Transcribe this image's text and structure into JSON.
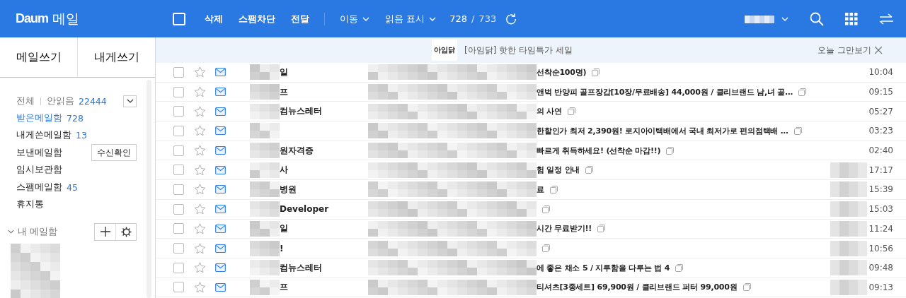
{
  "header": {
    "logo": "Daum",
    "service": "메일",
    "toolbar": [
      {
        "kind": "checkbox",
        "checked": false
      },
      {
        "kind": "button",
        "label": "삭제"
      },
      {
        "kind": "button",
        "label": "스팸차단"
      },
      {
        "kind": "button",
        "label": "전달"
      },
      {
        "kind": "separator"
      },
      {
        "kind": "dropdown",
        "label": "이동"
      },
      {
        "kind": "dropdown",
        "label": "읽음 표시"
      }
    ],
    "count": "728",
    "count_separator": "/",
    "total": "733"
  },
  "sidebar": {
    "compose": [
      "메일쓰기",
      "내게쓰기"
    ],
    "all": "전체",
    "unread_label": "안읽음",
    "unread_count": "22444",
    "folders": [
      {
        "label": "받은메일함",
        "count": "728",
        "selected": true
      },
      {
        "label": "내게쓴메일함",
        "count": "13",
        "selected": false
      },
      {
        "label": "보낸메일함",
        "button": "수신확인",
        "selected": false
      },
      {
        "label": "임시보관함",
        "selected": false
      },
      {
        "label": "스팸메일함",
        "count": "45",
        "selected": false
      },
      {
        "label": "휴지통",
        "selected": false
      }
    ],
    "my_mailbox": {
      "label": "내 메일함",
      "expanded": true
    }
  },
  "banner": {
    "logo": "아임닭",
    "text": "[아임닭] 핫한 타임특가 세일",
    "dismiss": "오늘 그만보기"
  },
  "mails": [
    {
      "sender": "일",
      "subject": "선착순100명)",
      "time": "10:04",
      "starred": false,
      "checked": false,
      "date_hidden": false
    },
    {
      "sender": "프",
      "subject": "앤벅 반양피 골프장갑[10장/무료배송] 44,000원 / 클리브랜드 남,녀 골…",
      "time": "09:15",
      "starred": false,
      "checked": false,
      "date_hidden": false
    },
    {
      "sender": "컴뉴스레터",
      "subject": "의 사연",
      "time": "05:27",
      "starred": false,
      "checked": false,
      "date_hidden": false
    },
    {
      "subject": "한할인가 최저 2,390원! 로지아이택배에서 국내 최저가로 편의점택배 …",
      "time": "03:23",
      "starred": false,
      "checked": false,
      "date_hidden": false
    },
    {
      "sender": "원자격증",
      "subject": "빠르게 취득하세요! (선착순 마감!!)",
      "time": "02:40",
      "starred": false,
      "checked": false,
      "date_hidden": false
    },
    {
      "sender": "사",
      "subject": "험 일정 안내",
      "time": "17:17",
      "starred": false,
      "checked": false,
      "date_hidden": true
    },
    {
      "sender": "병원",
      "subject": "료",
      "time": "15:39",
      "starred": false,
      "checked": false,
      "date_hidden": true
    },
    {
      "sender": "Developer",
      "time": "15:03",
      "starred": false,
      "checked": false,
      "date_hidden": true
    },
    {
      "sender": "일",
      "subject": "시간 무료받기!!",
      "time": "11:24",
      "starred": false,
      "checked": false,
      "date_hidden": true
    },
    {
      "sender": "!",
      "time": "10:56",
      "starred": false,
      "checked": false,
      "date_hidden": true
    },
    {
      "sender": "컴뉴스레터",
      "subject": "에 좋은 채소 5 / 지루함을 다루는 법 4",
      "time": "09:48",
      "starred": false,
      "checked": false,
      "date_hidden": true
    },
    {
      "sender": "프",
      "subject": "티셔츠[3종세트] 69,900원 / 클리브랜드 퍼터 99,000원",
      "time": "09:13",
      "starred": false,
      "checked": false,
      "date_hidden": true
    }
  ]
}
